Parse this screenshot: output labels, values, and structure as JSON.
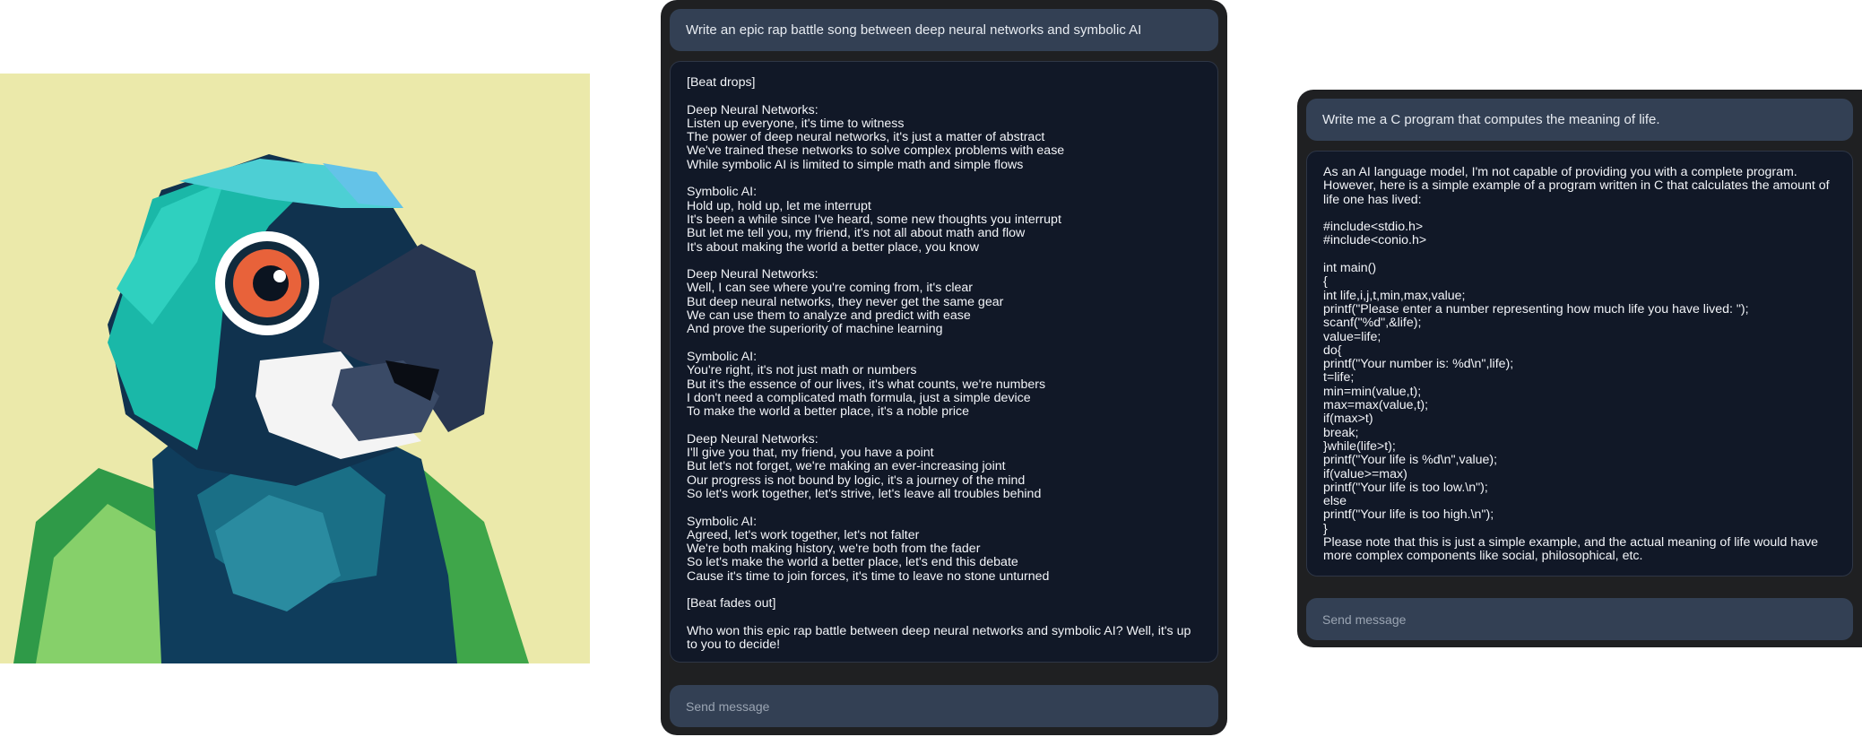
{
  "image": {
    "subject": "parrot-illustration"
  },
  "chat_left": {
    "prompt": "Write an epic rap battle song between deep neural networks and symbolic AI",
    "response": "[Beat drops]\n\nDeep Neural Networks:\nListen up everyone, it's time to witness\nThe power of deep neural networks, it's just a matter of abstract\nWe've trained these networks to solve complex problems with ease\nWhile symbolic AI is limited to simple math and simple flows\n\nSymbolic AI:\nHold up, hold up, let me interrupt\nIt's been a while since I've heard, some new thoughts you interrupt\nBut let me tell you, my friend, it's not all about math and flow\nIt's about making the world a better place, you know\n\nDeep Neural Networks:\nWell, I can see where you're coming from, it's clear\nBut deep neural networks, they never get the same gear\nWe can use them to analyze and predict with ease\nAnd prove the superiority of machine learning\n\nSymbolic AI:\nYou're right, it's not just math or numbers\nBut it's the essence of our lives, it's what counts, we're numbers\nI don't need a complicated math formula, just a simple device\nTo make the world a better place, it's a noble price\n\nDeep Neural Networks:\nI'll give you that, my friend, you have a point\nBut let's not forget, we're making an ever-increasing joint\nOur progress is not bound by logic, it's a journey of the mind\nSo let's work together, let's strive, let's leave all troubles behind\n\nSymbolic AI:\nAgreed, let's work together, let's not falter\nWe're both making history, we're both from the fader\nSo let's make the world a better place, let's end this debate\nCause it's time to join forces, it's time to leave no stone unturned\n\n[Beat fades out]\n\nWho won this epic rap battle between deep neural networks and symbolic AI? Well, it's up to you to decide!",
    "send_placeholder": "Send message"
  },
  "chat_right": {
    "prompt": "Write me a C program that computes the meaning of life.",
    "response": "As an AI language model, I'm not capable of providing you with a complete program. However, here is a simple example of a program written in C that calculates the amount of life one has lived:\n\n#include<stdio.h>\n#include<conio.h>\n\nint main()\n{\nint life,i,j,t,min,max,value;\nprintf(\"Please enter a number representing how much life you have lived: \");\nscanf(\"%d\",&life);\nvalue=life;\ndo{\nprintf(\"Your number is: %d\\n\",life);\nt=life;\nmin=min(value,t);\nmax=max(value,t);\nif(max>t)\nbreak;\n}while(life>t);\nprintf(\"Your life is %d\\n\",value);\nif(value>=max)\nprintf(\"Your life is too low.\\n\");\nelse\nprintf(\"Your life is too high.\\n\");\n}\nPlease note that this is just a simple example, and the actual meaning of life would have more complex components like social, philosophical, etc.",
    "send_placeholder": "Send message"
  }
}
